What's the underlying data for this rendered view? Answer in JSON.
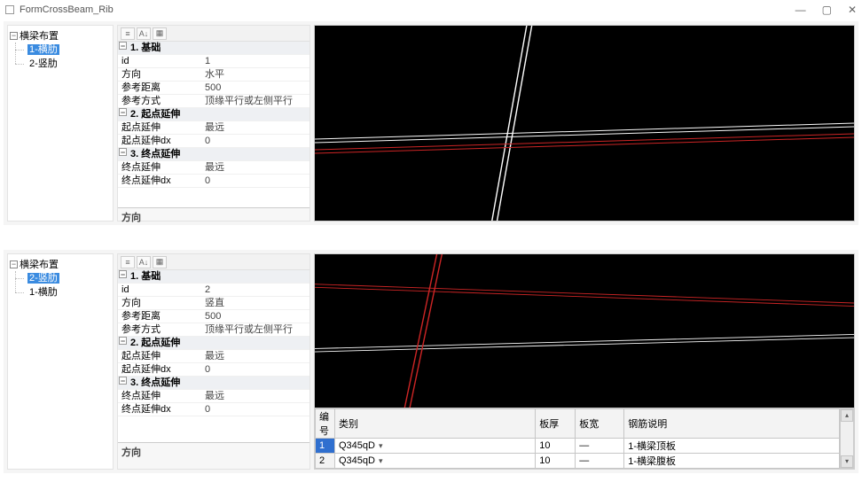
{
  "window": {
    "title": "FormCrossBeam_Rib",
    "btn_min": "—",
    "btn_max": "▢",
    "btn_close": "✕"
  },
  "tree1": {
    "root": "横梁布置",
    "items": [
      {
        "label": "1-横肋",
        "selected": true
      },
      {
        "label": "2-竖肋",
        "selected": false
      }
    ]
  },
  "tree2": {
    "root": "横梁布置",
    "items": [
      {
        "label": "2-竖肋",
        "selected": true
      },
      {
        "label": "1-横肋",
        "selected": false
      }
    ]
  },
  "props1": {
    "cat1": "1. 基础",
    "rows1": [
      {
        "k": "id",
        "v": "1"
      },
      {
        "k": "方向",
        "v": "水平"
      },
      {
        "k": "参考距离",
        "v": "500"
      },
      {
        "k": "参考方式",
        "v": "顶缘平行或左侧平行"
      }
    ],
    "cat2": "2. 起点延伸",
    "rows2": [
      {
        "k": "起点延伸",
        "v": "最远"
      },
      {
        "k": "起点延伸dx",
        "v": "0"
      }
    ],
    "cat3": "3. 终点延伸",
    "rows3": [
      {
        "k": "终点延伸",
        "v": "最远"
      },
      {
        "k": "终点延伸dx",
        "v": "0"
      }
    ],
    "desc": "方向"
  },
  "props2": {
    "cat1": "1. 基础",
    "rows1": [
      {
        "k": "id",
        "v": "2"
      },
      {
        "k": "方向",
        "v": "竖直"
      },
      {
        "k": "参考距离",
        "v": "500"
      },
      {
        "k": "参考方式",
        "v": "顶缘平行或左侧平行"
      }
    ],
    "cat2": "2. 起点延伸",
    "rows2": [
      {
        "k": "起点延伸",
        "v": "最远"
      },
      {
        "k": "起点延伸dx",
        "v": "0"
      }
    ],
    "cat3": "3. 终点延伸",
    "rows3": [
      {
        "k": "终点延伸",
        "v": "最远"
      },
      {
        "k": "终点延伸dx",
        "v": "0"
      }
    ],
    "desc": "方向"
  },
  "grid": {
    "headers": [
      "编号",
      "类别",
      "板厚",
      "板宽",
      "钢筋说明"
    ],
    "rows": [
      {
        "num": "1",
        "cat": "Q345qD",
        "thk": "10",
        "wid": "—",
        "desc": "1-横梁顶板"
      },
      {
        "num": "2",
        "cat": "Q345qD",
        "thk": "10",
        "wid": "—",
        "desc": "1-横梁腹板"
      }
    ],
    "dd": "▾"
  },
  "glyphs": {
    "minus": "−",
    "sort": "A↓",
    "az": "≡",
    "grid": "▦"
  }
}
